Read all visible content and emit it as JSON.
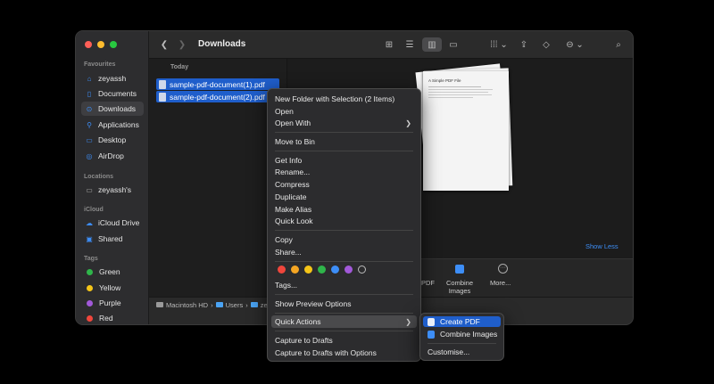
{
  "window": {
    "title": "Downloads",
    "traffic_colors": [
      "#fe5f57",
      "#febc2e",
      "#28c840"
    ]
  },
  "sidebar": {
    "favourites_header": "Favourites",
    "favourites": [
      {
        "label": "zeyassh",
        "icon": "home-icon"
      },
      {
        "label": "Documents",
        "icon": "document-icon"
      },
      {
        "label": "Downloads",
        "icon": "download-icon",
        "active": true
      },
      {
        "label": "Applications",
        "icon": "applications-icon"
      },
      {
        "label": "Desktop",
        "icon": "desktop-icon"
      },
      {
        "label": "AirDrop",
        "icon": "airdrop-icon"
      }
    ],
    "locations_header": "Locations",
    "locations": [
      {
        "label": "zeyassh's",
        "icon": "computer-icon"
      }
    ],
    "icloud_header": "iCloud",
    "icloud": [
      {
        "label": "iCloud Drive",
        "icon": "cloud-icon"
      },
      {
        "label": "Shared",
        "icon": "shared-folder-icon"
      }
    ],
    "tags_header": "Tags",
    "tags": [
      {
        "label": "Green",
        "color": "#2fb54a"
      },
      {
        "label": "Yellow",
        "color": "#f5c518"
      },
      {
        "label": "Purple",
        "color": "#a259d9"
      },
      {
        "label": "Red",
        "color": "#f0463c"
      }
    ]
  },
  "filelist": {
    "group_header": "Today",
    "files": [
      {
        "name": "sample-pdf-document(1).pdf"
      },
      {
        "name": "sample-pdf-document(2).pdf"
      }
    ]
  },
  "preview": {
    "doc_title": "A Simple PDF File",
    "show_less": "Show Less",
    "quick_actions": [
      {
        "label": "PDF"
      },
      {
        "label": "Combine\nImages"
      },
      {
        "label": "More..."
      }
    ]
  },
  "pathbar": {
    "items": [
      "Macintosh HD",
      "Users",
      "ze"
    ]
  },
  "context_menu": {
    "items": {
      "new_folder": "New Folder with Selection (2 Items)",
      "open": "Open",
      "open_with": "Open With",
      "move_to_bin": "Move to Bin",
      "get_info": "Get Info",
      "rename": "Rename...",
      "compress": "Compress",
      "duplicate": "Duplicate",
      "make_alias": "Make Alias",
      "quick_look": "Quick Look",
      "copy": "Copy",
      "share": "Share...",
      "tags": "Tags...",
      "show_preview_options": "Show Preview Options",
      "quick_actions": "Quick Actions",
      "capture_to_drafts": "Capture to Drafts",
      "capture_to_drafts_options": "Capture to Drafts with Options"
    },
    "tag_colors": [
      "#f0463c",
      "#f5a623",
      "#f5c518",
      "#2fb54a",
      "#3d8ef7",
      "#a259d9"
    ]
  },
  "submenu": {
    "create_pdf": "Create PDF",
    "combine_images": "Combine Images",
    "customise": "Customise..."
  }
}
